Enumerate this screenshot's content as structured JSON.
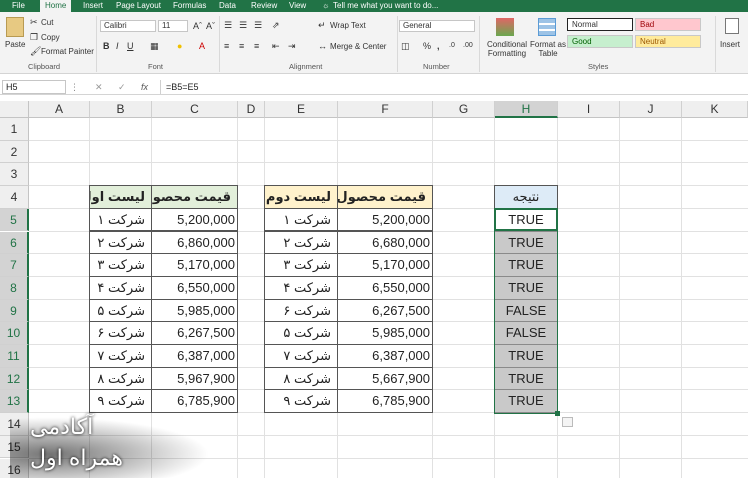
{
  "ribbon_tabs": [
    "File",
    "Home",
    "Insert",
    "Page Layout",
    "Formulas",
    "Data",
    "Review",
    "View"
  ],
  "tell_me": "Tell me what you want to do...",
  "clipboard": {
    "paste": "Paste",
    "cut": "Cut",
    "copy": "Copy",
    "format_painter": "Format Painter",
    "group": "Clipboard"
  },
  "font": {
    "name": "Calibri",
    "size": "11",
    "group": "Font"
  },
  "alignment": {
    "wrap": "Wrap Text",
    "merge": "Merge & Center",
    "group": "Alignment"
  },
  "number": {
    "format": "General",
    "group": "Number"
  },
  "styles": {
    "conditional": "Conditional Formatting",
    "format_table": "Format as Table",
    "normal": "Normal",
    "bad": "Bad",
    "good": "Good",
    "neutral": "Neutral",
    "group": "Styles"
  },
  "cells": {
    "insert": "Insert"
  },
  "formula_bar": {
    "name_box": "H5",
    "formula": "=B5=E5",
    "fx": "fx"
  },
  "columns": [
    "A",
    "B",
    "C",
    "D",
    "E",
    "F",
    "G",
    "H",
    "I",
    "J",
    "K"
  ],
  "rows": [
    "1",
    "2",
    "3",
    "4",
    "5",
    "6",
    "7",
    "8",
    "9",
    "10",
    "11",
    "12",
    "13",
    "14",
    "15",
    "16"
  ],
  "table1": {
    "header_name": "لیست اول",
    "header_price": "قیمت محصول",
    "names": [
      "شرکت ۱",
      "شرکت ۲",
      "شرکت ۳",
      "شرکت ۴",
      "شرکت ۵",
      "شرکت ۶",
      "شرکت ۷",
      "شرکت ۸",
      "شرکت ۹"
    ],
    "prices": [
      "5,200,000",
      "6,860,000",
      "5,170,000",
      "6,550,000",
      "5,985,000",
      "6,267,500",
      "6,387,000",
      "5,967,900",
      "6,785,900"
    ]
  },
  "table2": {
    "header_name": "لیست دوم",
    "header_price": "قیمت محصول",
    "names": [
      "شرکت ۱",
      "شرکت ۲",
      "شرکت ۳",
      "شرکت ۴",
      "شرکت ۶",
      "شرکت ۵",
      "شرکت ۷",
      "شرکت ۸",
      "شرکت ۹"
    ],
    "prices": [
      "5,200,000",
      "6,680,000",
      "5,170,000",
      "6,550,000",
      "6,267,500",
      "5,985,000",
      "6,387,000",
      "5,667,900",
      "6,785,900"
    ]
  },
  "result": {
    "header": "نتیجه",
    "values": [
      "TRUE",
      "TRUE",
      "TRUE",
      "TRUE",
      "FALSE",
      "FALSE",
      "TRUE",
      "TRUE",
      "TRUE"
    ]
  },
  "watermark": {
    "line1": "آکادمی",
    "line2": "همراه اول"
  },
  "colors": {
    "green": "#217346",
    "header_green": "#e2efda",
    "header_yellow": "#fff2cc",
    "header_blue": "#ddebf7",
    "result_gray": "#c9c9c9"
  }
}
